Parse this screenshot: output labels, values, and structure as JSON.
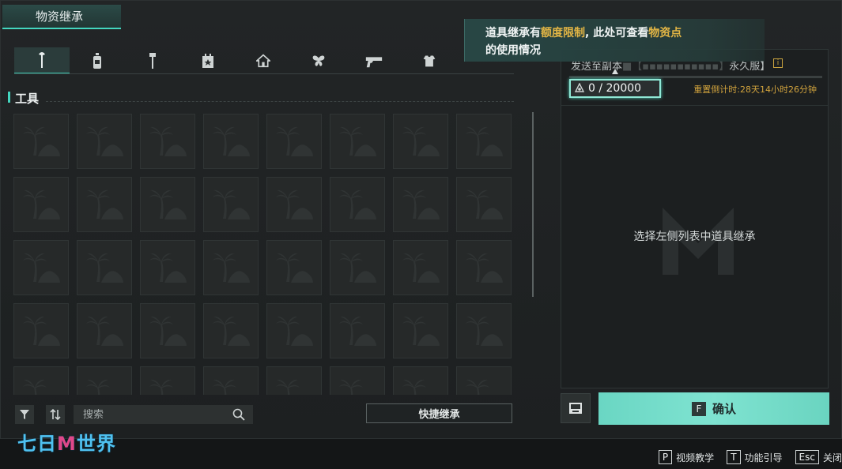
{
  "window": {
    "title": "物资继承"
  },
  "category_tabs": [
    {
      "name": "wrench-icon",
      "active": true
    },
    {
      "name": "bottle-icon",
      "active": false
    },
    {
      "name": "hammer-icon",
      "active": false
    },
    {
      "name": "box-star-icon",
      "active": false
    },
    {
      "name": "house-icon",
      "active": false
    },
    {
      "name": "butterfly-icon",
      "active": false
    },
    {
      "name": "pistol-icon",
      "active": false
    },
    {
      "name": "shirt-icon",
      "active": false
    }
  ],
  "section": {
    "title": "工具"
  },
  "grid": {
    "columns": 8,
    "visible_rows": 5,
    "empty_slot_icon": "palm-tree-placeholder-icon"
  },
  "controls": {
    "search_placeholder": "搜索",
    "quick_inherit_label": "快捷继承"
  },
  "right_panel": {
    "header_prefix": "发送至副本",
    "header_obscured": "■【▪▪▪▪▪▪▪▪▪▪▪】",
    "header_suffix": "永久服】",
    "info_badge": "i",
    "points_text": "0 / 20000",
    "reset_text": "重置倒计时:28天14小时26分钟",
    "empty_hint": "选择左侧列表中道具继承"
  },
  "tooltip": {
    "part1": "道具继承有",
    "highlight1": "额度限制",
    "part2": ", 此处可查看",
    "highlight2": "物资点",
    "line2": "的使用情况"
  },
  "confirm": {
    "key": "F",
    "label": "确认"
  },
  "logo": {
    "left": "七日",
    "mid": "M",
    "right": "世界"
  },
  "hotkeys": [
    {
      "key": "P",
      "label": "视频教学"
    },
    {
      "key": "T",
      "label": "功能引导"
    },
    {
      "key": "Esc",
      "label": "关闭"
    }
  ],
  "colors": {
    "accent": "#43d6bf",
    "highlight": "#e2b545",
    "confirm_bg": "#7fe3d1"
  }
}
